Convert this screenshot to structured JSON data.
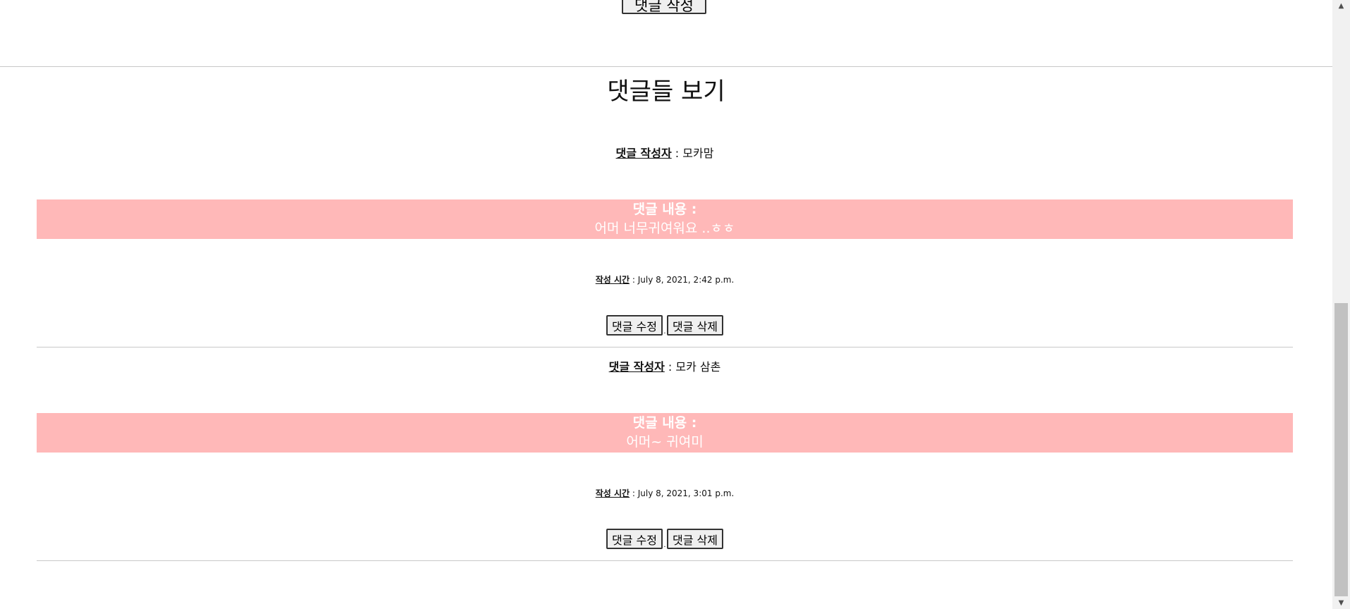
{
  "form": {
    "submit_label": "댓글 작성"
  },
  "section": {
    "title": "댓글들 보기"
  },
  "comments": [
    {
      "author_label": "댓글 작성자",
      "author_sep": " : ",
      "author": "모카맘",
      "content_label": "댓글 내용 :",
      "content": "어머 너무귀여워요 ..ㅎㅎ",
      "time_label": "작성 시간",
      "time_sep": " : ",
      "time": "July 8, 2021, 2:42 p.m.",
      "edit_label": "댓글 수정",
      "delete_label": "댓글 삭제",
      "separator": "."
    },
    {
      "author_label": "댓글 작성자",
      "author_sep": " : ",
      "author": "모카 삼촌",
      "content_label": "댓글 내용 :",
      "content": "어머~ 귀여미",
      "time_label": "작성 시간",
      "time_sep": " : ",
      "time": "July 8, 2021, 3:01 p.m.",
      "edit_label": "댓글 수정",
      "delete_label": "댓글 삭제",
      "separator": "."
    }
  ],
  "scrollbar": {
    "up_icon": "arrow-up-icon",
    "down_icon": "arrow-down-icon",
    "up_glyph": "▲",
    "down_glyph": "▼"
  }
}
